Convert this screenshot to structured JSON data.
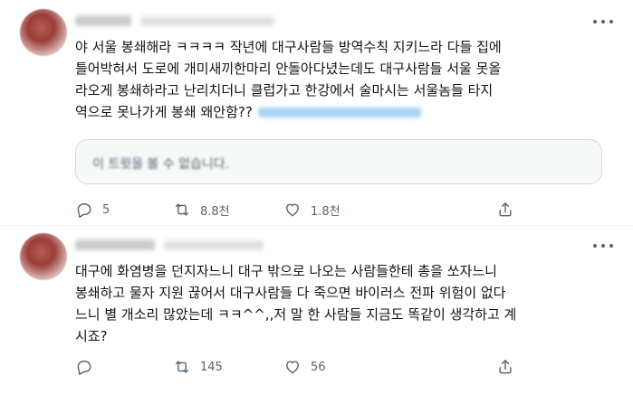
{
  "tweets": [
    {
      "lines": [
        "야 서울 봉쇄해라 ㅋㅋㅋㅋ 작년에 대구사람들 방역수칙 지키느라 다들 집에",
        "틀어박혀서 도로에 개미새끼한마리 안돌아다녔는데도 대구사람들 서울 못올",
        "라오게 봉쇄하라고 난리치더니 클럽가고 한강에서 술마시는 서울놈들 타지",
        "역으로 못나가게 봉쇄 왜안함??"
      ],
      "quote_text": "이 트윗을 볼 수 없습니다.",
      "reply_count": "5",
      "retweet_count": "8.8천",
      "like_count": "1.8천"
    },
    {
      "lines": [
        "대구에 화염병을 던지자느니 대구 밖으로 나오는 사람들한테 총을 쏘자느니",
        "봉쇄하고 물자 지원 끊어서 대구사람들 다 죽으면 바이러스 전파 위험이 없다",
        "느니 별 개소리 많았는데 ㅋㅋ^^,,저 말 한 사람들 지금도 똑같이 생각하고 계",
        "시죠?"
      ],
      "reply_count": "",
      "retweet_count": "145",
      "like_count": "56"
    }
  ],
  "icons": [
    "more-icon",
    "reply-icon",
    "retweet-icon",
    "like-icon",
    "share-icon"
  ],
  "colors": {
    "text": "#0f1419",
    "secondary": "#536471",
    "border": "#cfd9de"
  }
}
